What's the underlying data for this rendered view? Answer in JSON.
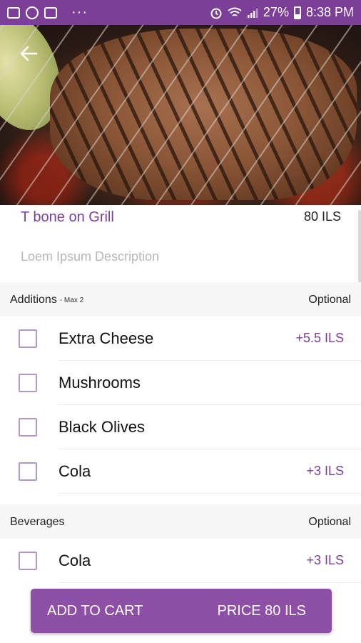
{
  "status_bar": {
    "icons_left": [
      "image-icon",
      "messenger-icon",
      "mail-icon"
    ],
    "more": "···",
    "battery": "27%",
    "time": "8:38 PM"
  },
  "colors": {
    "accent": "#7b3f98",
    "button": "#8e4fa6",
    "checkbox_border": "#b596c8"
  },
  "item": {
    "title": "T bone on Grill",
    "price": "80 ILS",
    "description": "Loem Ipsum Description"
  },
  "additions": {
    "header": "Additions",
    "sub": "- Max 2",
    "optional": "Optional",
    "options": [
      {
        "label": "Extra Cheese",
        "price": "+5.5 ILS"
      },
      {
        "label": "Mushrooms",
        "price": ""
      },
      {
        "label": "Black Olives",
        "price": ""
      },
      {
        "label": "Cola",
        "price": "+3 ILS"
      }
    ]
  },
  "beverages": {
    "header": "Beverages",
    "optional": "Optional",
    "options": [
      {
        "label": "Cola",
        "price": "+3 ILS"
      }
    ]
  },
  "cart_button": {
    "label": "ADD TO CART",
    "price": "PRICE 80 ILS"
  }
}
